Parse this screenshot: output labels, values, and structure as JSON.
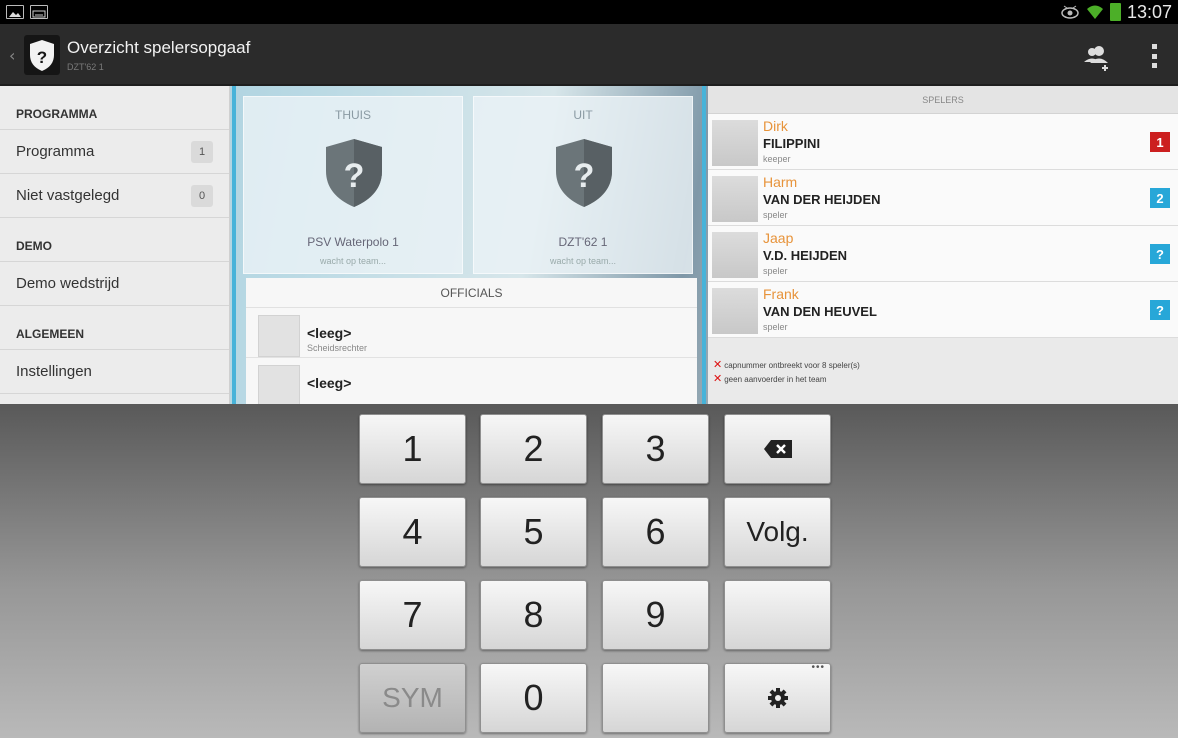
{
  "status_bar": {
    "time": "13:07"
  },
  "action_bar": {
    "title": "Overzicht spelersopgaaf",
    "subtitle": "DZT'62 1"
  },
  "nav": {
    "sections": [
      {
        "title": "PROGRAMMA",
        "items": [
          {
            "label": "Programma",
            "count": "1"
          },
          {
            "label": "Niet vastgelegd",
            "count": "0"
          }
        ]
      },
      {
        "title": "DEMO",
        "items": [
          {
            "label": "Demo wedstrijd"
          }
        ]
      },
      {
        "title": "ALGEMEEN",
        "items": [
          {
            "label": "Instellingen"
          }
        ]
      }
    ]
  },
  "teams": {
    "home": {
      "label": "THUIS",
      "name": "PSV Waterpolo 1",
      "status": "wacht op team..."
    },
    "away": {
      "label": "UIT",
      "name": "DZT'62 1",
      "status": "wacht op team..."
    }
  },
  "officials": {
    "title": "OFFICIALS",
    "items": [
      {
        "name": "<leeg>",
        "role": "Scheidsrechter"
      },
      {
        "name": "<leeg>",
        "role": ""
      }
    ]
  },
  "players": {
    "title": "SPELERS",
    "items": [
      {
        "first": "Dirk",
        "last": "FILIPPINI",
        "role": "keeper",
        "cap": "1",
        "cap_color": "#cc1f1f"
      },
      {
        "first": "Harm",
        "last": "VAN DER HEIJDEN",
        "role": "speler",
        "cap": "2",
        "cap_color": "#27a7d8"
      },
      {
        "first": "Jaap",
        "last": "V.D. HEIJDEN",
        "role": "speler",
        "cap": "?",
        "cap_color": "#27a7d8"
      },
      {
        "first": "Frank",
        "last": "VAN DEN HEUVEL",
        "role": "speler",
        "cap": "?",
        "cap_color": "#27a7d8"
      }
    ],
    "warnings": [
      "capnummer ontbreekt voor 8 speler(s)",
      "geen aanvoerder in het team"
    ]
  },
  "keyboard": {
    "keys": {
      "k1": "1",
      "k2": "2",
      "k3": "3",
      "k4": "4",
      "k5": "5",
      "k6": "6",
      "next": "Volg.",
      "k7": "7",
      "k8": "8",
      "k9": "9",
      "sym": "SYM",
      "k0": "0"
    }
  },
  "colors": {
    "accent": "#47b3d9",
    "first_name": "#e7933a",
    "cap_red": "#cc1f1f",
    "cap_blue": "#27a7d8"
  }
}
